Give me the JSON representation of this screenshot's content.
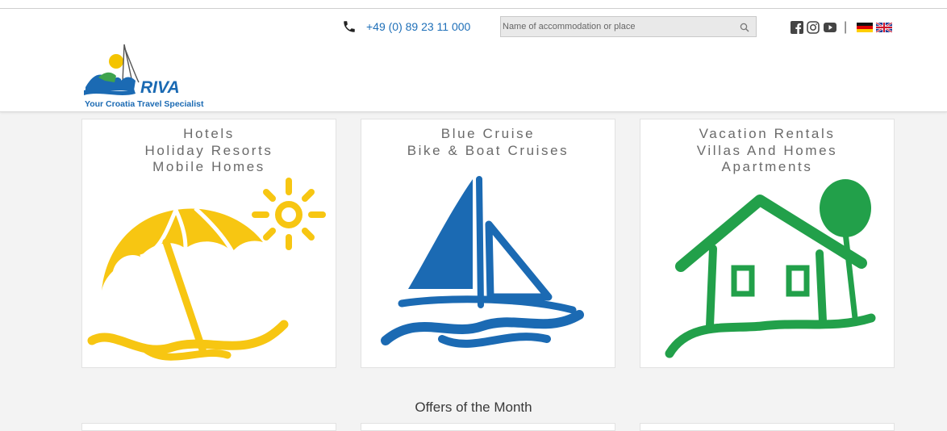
{
  "header": {
    "phone": "+49 (0) 89 23 11 000",
    "search_placeholder": "Name of accommodation or place",
    "separator": "|",
    "social": [
      "facebook-icon",
      "instagram-icon",
      "youtube-icon"
    ],
    "languages": [
      "german-flag-icon",
      "uk-flag-icon"
    ]
  },
  "logo": {
    "brand": "RIVA",
    "tagline": "Your Croatia Travel Specialist",
    "colors": {
      "blue": "#1b6ab3",
      "green": "#3fa34d",
      "yellow": "#f4c400"
    }
  },
  "categories": [
    {
      "lines": [
        "Hotels",
        "Holiday Resorts",
        "Mobile Homes"
      ],
      "icon": "beach-umbrella-sun-icon",
      "color": "#f7c612"
    },
    {
      "lines": [
        "Blue Cruise",
        "Bike & Boat Cruises"
      ],
      "icon": "sailboat-icon",
      "color": "#1b6ab3"
    },
    {
      "lines": [
        "Vacation Rentals",
        "Villas And Homes",
        "Apartments"
      ],
      "icon": "house-tree-icon",
      "color": "#22a04a"
    }
  ],
  "offers_heading": "Offers of the Month",
  "colors": {
    "accent": "#1e6fb8",
    "background": "#f3f3f3"
  }
}
